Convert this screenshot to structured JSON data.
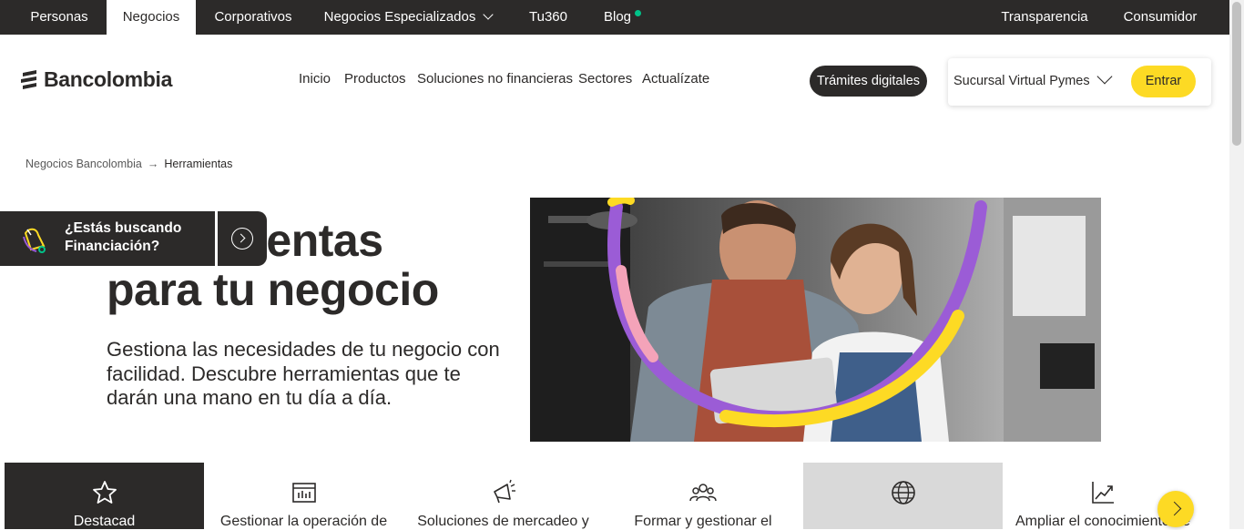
{
  "topbar": {
    "tabs": [
      {
        "label": "Personas"
      },
      {
        "label": "Negocios"
      },
      {
        "label": "Corporativos"
      },
      {
        "label": "Negocios Especializados"
      },
      {
        "label": "Tu360"
      },
      {
        "label": "Blog"
      }
    ],
    "right_links": [
      {
        "label": "Transparencia"
      },
      {
        "label": "Consumidor"
      }
    ],
    "active_tab": "Negocios"
  },
  "header": {
    "logo_text": "Bancolombia",
    "nav": [
      "Inicio",
      "Productos",
      "Soluciones no financieras",
      "Sectores",
      "Actualízate"
    ],
    "tramites_label": "Trámites digitales",
    "sucursal_label": "Sucursal Virtual Pymes",
    "entrar_label": "Entrar"
  },
  "breadcrumb": {
    "items": [
      "Negocios Bancolombia",
      "Herramientas"
    ],
    "separator": "→"
  },
  "hero": {
    "title_line1": "ientas",
    "title_line2": "para tu negocio",
    "description": "Gestiona las necesidades de tu negocio con facilidad. Descubre herramientas que te darán una mano en tu día a día."
  },
  "financing_banner": {
    "line1": "¿Estás buscando",
    "line2": "Financiación?"
  },
  "cards": [
    {
      "label": "Destacad",
      "icon": "star-icon",
      "style": "dark"
    },
    {
      "label": "Gestionar la operación de",
      "icon": "dashboard-icon",
      "style": "light"
    },
    {
      "label": "Soluciones de mercadeo y",
      "icon": "megaphone-icon",
      "style": "light"
    },
    {
      "label": "Formar y gestionar el",
      "icon": "team-icon",
      "style": "light"
    },
    {
      "label": "",
      "icon": "globe-icon",
      "style": "gray"
    },
    {
      "label": "Ampliar el conocimiento de",
      "icon": "growth-chart-icon",
      "style": "light"
    }
  ],
  "colors": {
    "brand_dark": "#2c2a29",
    "brand_yellow": "#fdda24",
    "accent_purple": "#9b5cd6",
    "status_green": "#00c389"
  }
}
